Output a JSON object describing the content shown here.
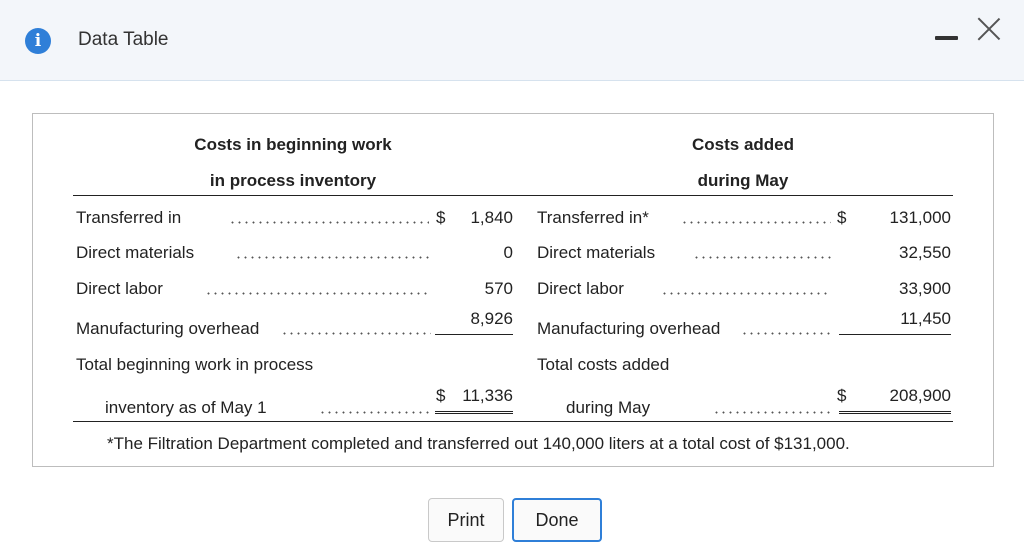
{
  "window": {
    "title": "Data Table",
    "info_icon_glyph": "i",
    "icons": [
      "info-icon",
      "minimize-icon",
      "close-icon"
    ],
    "accent_color": "#2f7fd8"
  },
  "table": {
    "left_header": [
      "Costs in beginning work",
      "in process inventory"
    ],
    "right_header": [
      "Costs added",
      "during May"
    ],
    "left_rows": [
      {
        "label": "Transferred in",
        "currency": "$",
        "value": "1,840"
      },
      {
        "label": "Direct materials",
        "currency": "",
        "value": "0"
      },
      {
        "label": "Direct labor",
        "currency": "",
        "value": "570"
      },
      {
        "label": "Manufacturing overhead",
        "currency": "",
        "value": "8,926"
      }
    ],
    "left_total": {
      "label_line1": "Total beginning work in process",
      "label_line2": "inventory as of May 1",
      "currency": "$",
      "value": "11,336"
    },
    "right_rows": [
      {
        "label": "Transferred in*",
        "currency": "$",
        "value": "131,000"
      },
      {
        "label": "Direct materials",
        "currency": "",
        "value": "32,550"
      },
      {
        "label": "Direct labor",
        "currency": "",
        "value": "33,900"
      },
      {
        "label": "Manufacturing overhead",
        "currency": "",
        "value": "11,450"
      }
    ],
    "right_total": {
      "label_line1": "Total costs added",
      "label_line2": "during May",
      "currency": "$",
      "value": "208,900"
    },
    "footnote": "*The Filtration Department completed and transferred out 140,000 liters at a total cost of $131,000."
  },
  "buttons": {
    "print": "Print",
    "done": "Done"
  }
}
